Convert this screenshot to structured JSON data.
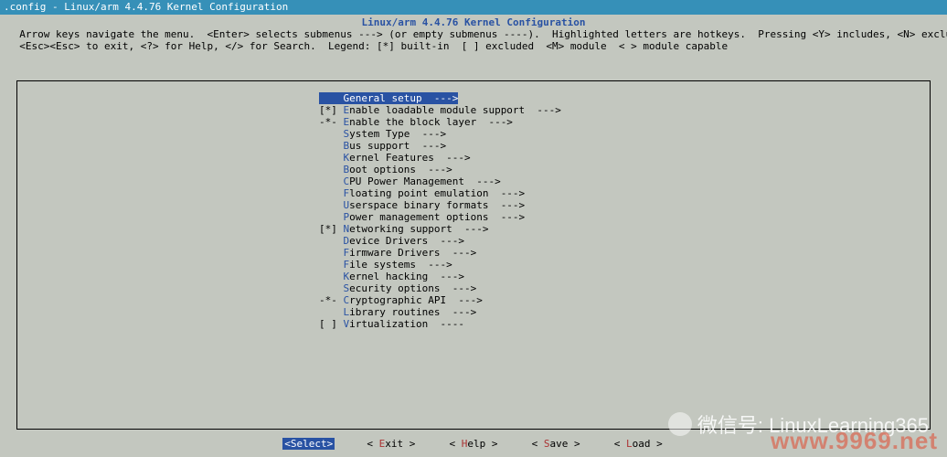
{
  "window": {
    "title": ".config - Linux/arm 4.4.76 Kernel Configuration"
  },
  "header": {
    "title": "Linux/arm 4.4.76 Kernel Configuration",
    "help_line1": "  Arrow keys navigate the menu.  <Enter> selects submenus ---> (or empty submenus ----).  Highlighted letters are hotkeys.  Pressing <Y> includes, <N> excludes, <M> modularizes features.  Press",
    "help_line2": "  <Esc><Esc> to exit, <?> for Help, </> for Search.  Legend: [*] built-in  [ ] excluded  <M> module  < > module capable"
  },
  "menu": {
    "items": [
      {
        "prefix": "    ",
        "hotkey": "G",
        "label": "eneral setup  --->",
        "selected": true
      },
      {
        "prefix": "[*] ",
        "hotkey": "E",
        "label": "nable loadable module support  --->",
        "selected": false
      },
      {
        "prefix": "-*- ",
        "hotkey": "E",
        "label": "nable the block layer  --->",
        "selected": false
      },
      {
        "prefix": "    ",
        "hotkey": "S",
        "label": "ystem Type  --->",
        "selected": false
      },
      {
        "prefix": "    ",
        "hotkey": "B",
        "label": "us support  --->",
        "selected": false
      },
      {
        "prefix": "    ",
        "hotkey": "K",
        "label": "ernel Features  --->",
        "selected": false
      },
      {
        "prefix": "    ",
        "hotkey": "B",
        "label": "oot options  --->",
        "selected": false
      },
      {
        "prefix": "    ",
        "hotkey": "C",
        "label": "PU Power Management  --->",
        "selected": false
      },
      {
        "prefix": "    ",
        "hotkey": "F",
        "label": "loating point emulation  --->",
        "selected": false
      },
      {
        "prefix": "    ",
        "hotkey": "U",
        "label": "serspace binary formats  --->",
        "selected": false
      },
      {
        "prefix": "    ",
        "hotkey": "P",
        "label": "ower management options  --->",
        "selected": false
      },
      {
        "prefix": "[*] ",
        "hotkey": "N",
        "label": "etworking support  --->",
        "selected": false
      },
      {
        "prefix": "    ",
        "hotkey": "D",
        "label": "evice Drivers  --->",
        "selected": false
      },
      {
        "prefix": "    ",
        "hotkey": "F",
        "label": "irmware Drivers  --->",
        "selected": false
      },
      {
        "prefix": "    ",
        "hotkey": "F",
        "label": "ile systems  --->",
        "selected": false
      },
      {
        "prefix": "    ",
        "hotkey": "K",
        "label": "ernel hacking  --->",
        "selected": false
      },
      {
        "prefix": "    ",
        "hotkey": "S",
        "label": "ecurity options  --->",
        "selected": false
      },
      {
        "prefix": "-*- ",
        "hotkey": "C",
        "label": "ryptographic API  --->",
        "selected": false
      },
      {
        "prefix": "    ",
        "hotkey": "L",
        "label": "ibrary routines  --->",
        "selected": false
      },
      {
        "prefix": "[ ] ",
        "hotkey": "V",
        "label": "irtualization  ----",
        "selected": false
      }
    ]
  },
  "buttons": {
    "select": "Select",
    "exit": "Exit",
    "help": "Help",
    "save": "Save",
    "load": "Load"
  },
  "watermark": {
    "text": "微信号: LinuxLearning365",
    "url": "www.9969.net"
  }
}
